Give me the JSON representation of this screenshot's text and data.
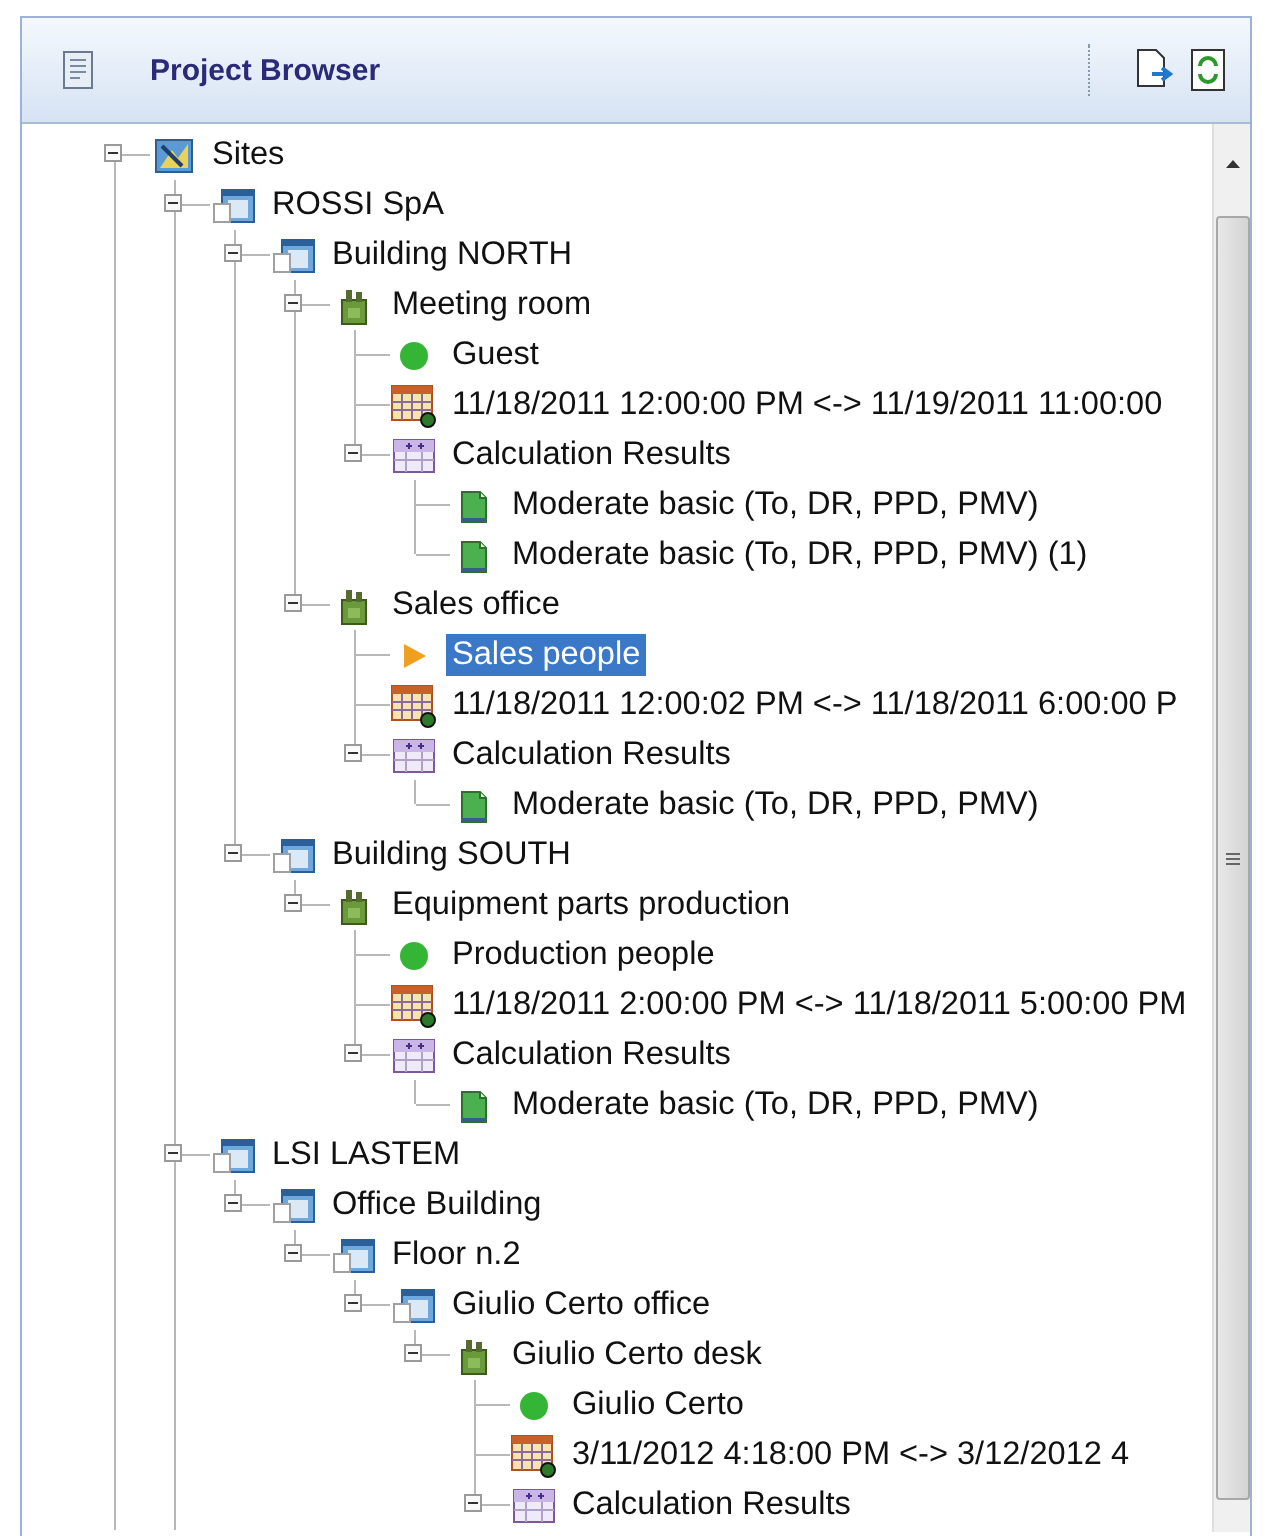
{
  "panel": {
    "title": "Project Browser"
  },
  "tree": [
    {
      "label": "Sites",
      "kind": "sites",
      "expanded": true,
      "selected": false,
      "more_below": true,
      "children": [
        {
          "label": "ROSSI SpA",
          "kind": "building",
          "expanded": true,
          "selected": false,
          "children": [
            {
              "label": "Building NORTH",
              "kind": "building",
              "expanded": true,
              "selected": false,
              "children": [
                {
                  "label": "Meeting room",
                  "kind": "room",
                  "expanded": true,
                  "selected": false,
                  "children": [
                    {
                      "label": "Guest",
                      "kind": "occupant",
                      "selected": false
                    },
                    {
                      "label": "11/18/2011 12:00:00 PM <-> 11/19/2011 11:00:00",
                      "kind": "schedule",
                      "selected": false
                    },
                    {
                      "label": "Calculation Results",
                      "kind": "results",
                      "expanded": true,
                      "selected": false,
                      "children": [
                        {
                          "label": "Moderate basic (To, DR, PPD, PMV)",
                          "kind": "result",
                          "selected": false
                        },
                        {
                          "label": "Moderate basic (To, DR, PPD, PMV) (1)",
                          "kind": "result",
                          "selected": false
                        }
                      ]
                    }
                  ]
                },
                {
                  "label": "Sales office",
                  "kind": "room",
                  "expanded": true,
                  "selected": false,
                  "children": [
                    {
                      "label": "Sales people",
                      "kind": "occupant-arrow",
                      "selected": true
                    },
                    {
                      "label": "11/18/2011 12:00:02 PM <-> 11/18/2011 6:00:00 P",
                      "kind": "schedule",
                      "selected": false
                    },
                    {
                      "label": "Calculation Results",
                      "kind": "results",
                      "expanded": true,
                      "selected": false,
                      "children": [
                        {
                          "label": "Moderate basic (To, DR, PPD, PMV)",
                          "kind": "result",
                          "selected": false
                        }
                      ]
                    }
                  ]
                }
              ]
            },
            {
              "label": "Building SOUTH",
              "kind": "building",
              "expanded": true,
              "selected": false,
              "children": [
                {
                  "label": "Equipment parts production",
                  "kind": "room",
                  "expanded": true,
                  "selected": false,
                  "children": [
                    {
                      "label": "Production people",
                      "kind": "occupant",
                      "selected": false
                    },
                    {
                      "label": "11/18/2011 2:00:00 PM <-> 11/18/2011 5:00:00 PM",
                      "kind": "schedule",
                      "selected": false
                    },
                    {
                      "label": "Calculation Results",
                      "kind": "results",
                      "expanded": true,
                      "selected": false,
                      "children": [
                        {
                          "label": "Moderate basic (To, DR, PPD, PMV)",
                          "kind": "result",
                          "selected": false
                        }
                      ]
                    }
                  ]
                }
              ]
            }
          ]
        },
        {
          "label": "LSI LASTEM",
          "kind": "building",
          "expanded": true,
          "selected": false,
          "more_below": true,
          "children": [
            {
              "label": "Office Building",
              "kind": "building",
              "expanded": true,
              "selected": false,
              "children": [
                {
                  "label": "Floor n.2",
                  "kind": "building",
                  "expanded": true,
                  "selected": false,
                  "children": [
                    {
                      "label": "Giulio Certo office",
                      "kind": "building",
                      "expanded": true,
                      "selected": false,
                      "children": [
                        {
                          "label": "Giulio Certo desk",
                          "kind": "room",
                          "expanded": true,
                          "selected": false,
                          "children": [
                            {
                              "label": "Giulio Certo",
                              "kind": "occupant",
                              "selected": false
                            },
                            {
                              "label": "3/11/2012 4:18:00 PM <-> 3/12/2012 4",
                              "kind": "schedule",
                              "selected": false
                            },
                            {
                              "label": "Calculation Results",
                              "kind": "results",
                              "expanded": true,
                              "selected": false
                            }
                          ]
                        }
                      ]
                    }
                  ]
                }
              ]
            }
          ]
        }
      ]
    }
  ]
}
